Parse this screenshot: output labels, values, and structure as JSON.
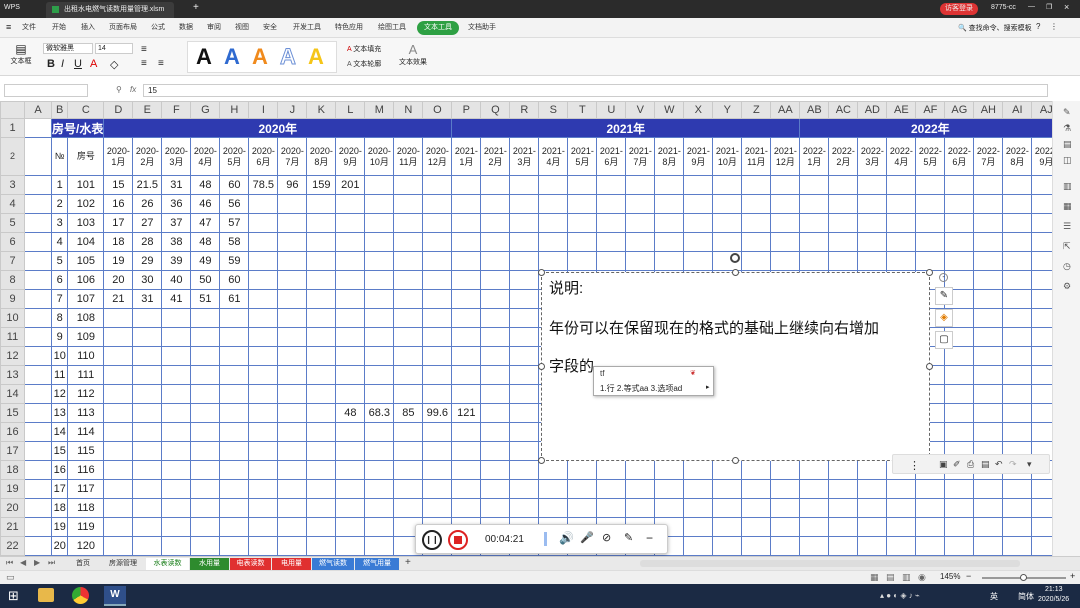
{
  "window": {
    "app_name": "WPS",
    "file_tab": "出租水电燃气读数用量管理.xlsm",
    "login_btn": "访客登录",
    "user_id": "8775-cc"
  },
  "menu": {
    "items": [
      "文件",
      "开始",
      "插入",
      "页面布局",
      "公式",
      "数据",
      "审阅",
      "视图",
      "安全",
      "开发工具",
      "特色应用",
      "绘图工具",
      "文本工具",
      "文档助手"
    ],
    "active": "文本工具",
    "search": "查找命令、搜索模板"
  },
  "ribbon": {
    "textbox_label": "文本框",
    "font_name": "微软雅黑",
    "font_size": "14",
    "bold": "B",
    "italic": "I",
    "underline": "U",
    "style_letter": "A",
    "text_fill": "文本填充",
    "text_outline": "文本轮廓",
    "text_effect": "文本效果"
  },
  "formula_bar": {
    "value": "15",
    "fx": "fx"
  },
  "sheet": {
    "col_headers": [
      "A",
      "B",
      "C",
      "D",
      "E",
      "F",
      "G",
      "H",
      "I",
      "J",
      "K",
      "L",
      "M",
      "N",
      "O",
      "P",
      "Q",
      "R",
      "S",
      "T",
      "U",
      "V",
      "W",
      "X",
      "Y",
      "Z",
      "AA",
      "AB",
      "AC",
      "AD",
      "AE",
      "AF",
      "AG",
      "AH",
      "AI",
      "AJ"
    ],
    "header_label": "房号/水表",
    "years": [
      "2020年",
      "2021年",
      "2022年"
    ],
    "no_label": "№",
    "room_label": "房号",
    "month_headers": [
      "2020-1月",
      "2020-2月",
      "2020-3月",
      "2020-4月",
      "2020-5月",
      "2020-6月",
      "2020-7月",
      "2020-8月",
      "2020-9月",
      "2020-10月",
      "2020-11月",
      "2020-12月",
      "2021-1月",
      "2021-2月",
      "2021-3月",
      "2021-4月",
      "2021-5月",
      "2021-6月",
      "2021-7月",
      "2021-8月",
      "2021-9月",
      "2021-10月",
      "2021-11月",
      "2021-12月",
      "2022-1月",
      "2022-2月",
      "2022-3月",
      "2022-4月",
      "2022-5月",
      "2022-6月",
      "2022-7月",
      "2022-8月",
      "2022-9月"
    ],
    "rows": [
      {
        "r": "3",
        "n": "1",
        "room": "101",
        "vals": [
          "15",
          "21.5",
          "31",
          "48",
          "60",
          "78.5",
          "96",
          "159",
          "201"
        ]
      },
      {
        "r": "4",
        "n": "2",
        "room": "102",
        "vals": [
          "16",
          "26",
          "36",
          "46",
          "56"
        ]
      },
      {
        "r": "5",
        "n": "3",
        "room": "103",
        "vals": [
          "17",
          "27",
          "37",
          "47",
          "57"
        ]
      },
      {
        "r": "6",
        "n": "4",
        "room": "104",
        "vals": [
          "18",
          "28",
          "38",
          "48",
          "58"
        ]
      },
      {
        "r": "7",
        "n": "5",
        "room": "105",
        "vals": [
          "19",
          "29",
          "39",
          "49",
          "59"
        ]
      },
      {
        "r": "8",
        "n": "6",
        "room": "106",
        "vals": [
          "20",
          "30",
          "40",
          "50",
          "60"
        ]
      },
      {
        "r": "9",
        "n": "7",
        "room": "107",
        "vals": [
          "21",
          "31",
          "41",
          "51",
          "61"
        ]
      },
      {
        "r": "10",
        "n": "8",
        "room": "108",
        "vals": []
      },
      {
        "r": "11",
        "n": "9",
        "room": "109",
        "vals": []
      },
      {
        "r": "12",
        "n": "10",
        "room": "110",
        "vals": []
      },
      {
        "r": "13",
        "n": "11",
        "room": "111",
        "vals": []
      },
      {
        "r": "14",
        "n": "12",
        "room": "112",
        "vals": []
      },
      {
        "r": "15",
        "n": "13",
        "room": "113",
        "vals": [
          "",
          "",
          "",
          "",
          "",
          "",
          "",
          "",
          "48",
          "68.3",
          "85",
          "99.6",
          "121"
        ]
      },
      {
        "r": "16",
        "n": "14",
        "room": "114",
        "vals": []
      },
      {
        "r": "17",
        "n": "15",
        "room": "115",
        "vals": []
      },
      {
        "r": "18",
        "n": "16",
        "room": "116",
        "vals": []
      },
      {
        "r": "19",
        "n": "17",
        "room": "117",
        "vals": []
      },
      {
        "r": "20",
        "n": "18",
        "room": "118",
        "vals": []
      },
      {
        "r": "21",
        "n": "19",
        "room": "119",
        "vals": []
      },
      {
        "r": "22",
        "n": "20",
        "room": "120",
        "vals": []
      }
    ]
  },
  "textbox": {
    "line1": "说明:",
    "line2": "年份可以在保留现在的格式的基础上继续向右增加",
    "line3": "字段的"
  },
  "ime": {
    "input": "tf",
    "candidates": "1.行 2.等式aa 3.选项ad"
  },
  "recorder": {
    "time": "00:04:21"
  },
  "sheet_tabs": {
    "tabs": [
      {
        "label": "首页",
        "color": "#e9e9e9",
        "text": "#333"
      },
      {
        "label": "房源管理",
        "color": "#e9e9e9",
        "text": "#333"
      },
      {
        "label": "水表读数",
        "color": "#ffffff",
        "text": "#1a7f1a"
      },
      {
        "label": "水用量",
        "color": "#2e8b2e",
        "text": "#ffffff"
      },
      {
        "label": "电表读数",
        "color": "#e03030",
        "text": "#ffffff"
      },
      {
        "label": "电用量",
        "color": "#e03030",
        "text": "#ffffff"
      },
      {
        "label": "燃气读数",
        "color": "#3a7bd5",
        "text": "#ffffff"
      },
      {
        "label": "燃气用量",
        "color": "#3a7bd5",
        "text": "#ffffff"
      }
    ]
  },
  "status": {
    "zoom": "145%"
  },
  "taskbar": {
    "time": "21:13",
    "date": "2020/5/26",
    "lang": "英",
    "ime_mode": "简体"
  }
}
